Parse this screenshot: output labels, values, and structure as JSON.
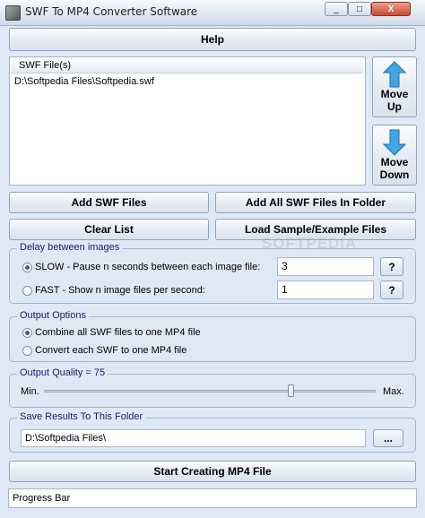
{
  "window": {
    "title": "SWF To MP4 Converter Software",
    "minimize": "_",
    "maximize": "□",
    "close": "X"
  },
  "help_label": "Help",
  "file_list": {
    "header": "SWF File(s)",
    "items": [
      "D:\\Softpedia Files\\Softpedia.swf"
    ]
  },
  "move_up_label": [
    "Move",
    "Up"
  ],
  "move_down_label": [
    "Move",
    "Down"
  ],
  "add_files_label": "Add SWF Files",
  "add_folder_label": "Add All SWF Files In Folder",
  "clear_label": "Clear List",
  "sample_label": "Load Sample/Example Files",
  "delay": {
    "title": "Delay between images",
    "slow_label": "SLOW - Pause n seconds between each image file:",
    "slow_value": "3",
    "fast_label": "FAST - Show n image files per second:",
    "fast_value": "1",
    "help_q": "?",
    "selected": "slow"
  },
  "output": {
    "title": "Output Options",
    "combine_label": "Combine all SWF files to one MP4 file",
    "each_label": "Convert each SWF to one MP4 file",
    "selected": "combine"
  },
  "quality": {
    "title": "Output Quality = 75",
    "min_label": "Min.",
    "max_label": "Max.",
    "value": 75
  },
  "save": {
    "title": "Save Results To This Folder",
    "path": "D:\\Softpedia Files\\",
    "browse": "..."
  },
  "start_label": "Start Creating MP4 File",
  "progress_label": "Progress Bar",
  "watermark": "SOFTPEDIA"
}
